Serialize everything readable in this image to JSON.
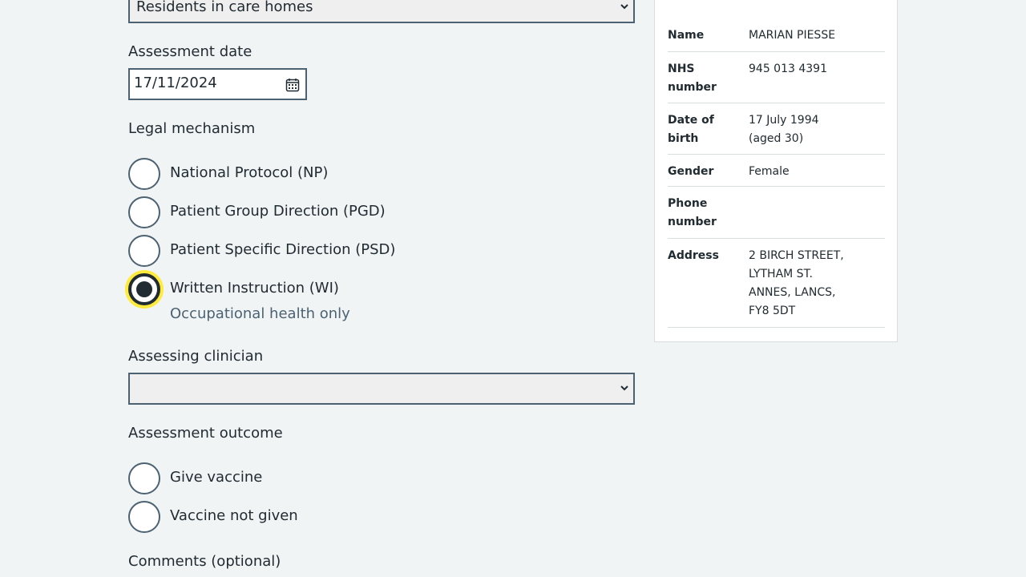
{
  "form": {
    "vaccination_setting": {
      "selected": "Residents in care homes"
    },
    "assessment_date": {
      "label": "Assessment date",
      "value": "17/11/2024"
    },
    "legal_mechanism": {
      "label": "Legal mechanism",
      "options": [
        {
          "label": "National Protocol (NP)",
          "checked": false
        },
        {
          "label": "Patient Group Direction (PGD)",
          "checked": false
        },
        {
          "label": "Patient Specific Direction (PSD)",
          "checked": false
        },
        {
          "label": "Written Instruction (WI)",
          "checked": true,
          "hint": "Occupational health only"
        }
      ]
    },
    "assessing_clinician": {
      "label": "Assessing clinician",
      "selected": ""
    },
    "assessment_outcome": {
      "label": "Assessment outcome",
      "options": [
        {
          "label": "Give vaccine",
          "checked": false
        },
        {
          "label": "Vaccine not given",
          "checked": false
        }
      ]
    },
    "comments": {
      "label": "Comments (optional)"
    }
  },
  "patient": {
    "name": {
      "key": "Name",
      "value": "MARIAN PIESSE"
    },
    "nhs_number": {
      "key_line1": "NHS",
      "key_line2": "number",
      "value": "945 013 4391"
    },
    "dob": {
      "key_line1": "Date of",
      "key_line2": "birth",
      "value_line1": "17 July 1994",
      "value_line2": "(aged 30)"
    },
    "gender": {
      "key": "Gender",
      "value": "Female"
    },
    "phone": {
      "key_line1": "Phone",
      "key_line2": "number",
      "value": ""
    },
    "address": {
      "key": "Address",
      "lines": [
        "2 BIRCH STREET,",
        "LYTHAM ST.",
        "ANNES, LANCS,",
        "FY8 5DT"
      ]
    }
  },
  "icons": {
    "calendar": "calendar-icon",
    "chevron": "chevron-down-icon"
  }
}
